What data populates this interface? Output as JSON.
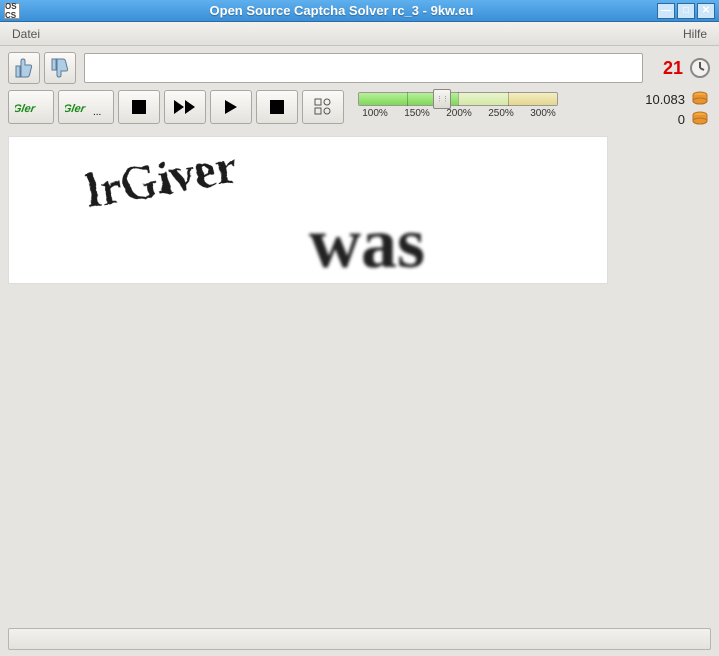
{
  "window": {
    "title": "Open Source Captcha Solver rc_3 - 9kw.eu",
    "app_icon_text": "OS\nCS"
  },
  "menubar": {
    "file": "Datei",
    "help": "Hilfe"
  },
  "input": {
    "value": "",
    "placeholder": ""
  },
  "timer": {
    "value": "21"
  },
  "zoom": {
    "labels": [
      "100%",
      "150%",
      "200%",
      "250%",
      "300%"
    ]
  },
  "stats": {
    "credits": "10.083",
    "queue": "0"
  },
  "buttons": {
    "thumbs_up": "thumbs-up",
    "thumbs_down": "thumbs-down"
  },
  "statusbar": {
    "text": ""
  }
}
